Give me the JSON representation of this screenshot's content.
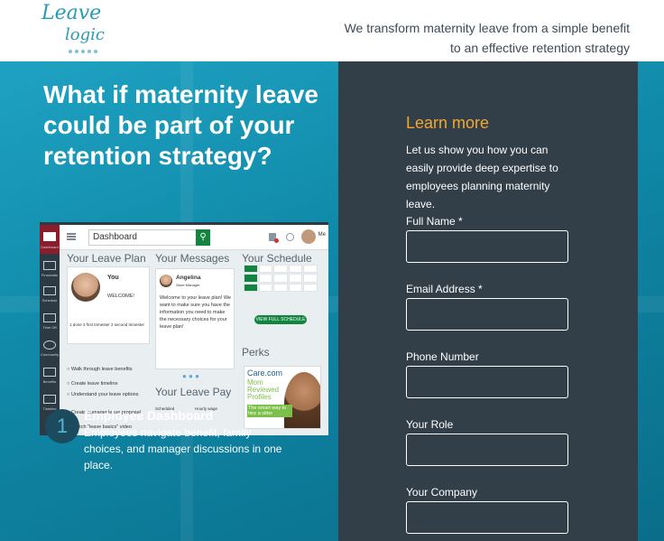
{
  "header": {
    "logo_line1": "Leave",
    "logo_line2": "logic",
    "tagline": "We transform maternity leave from a simple benefit to an effective retention strategy"
  },
  "hero": {
    "title": "What if maternity leave could be part of your retention strategy?"
  },
  "dashboard_mock": {
    "sidebar": [
      "Dashboard",
      "Financials",
      "Schedule",
      "Time Off",
      "Community",
      "Benefits",
      "Timeline"
    ],
    "search_value": "Dashboard",
    "user_label": "Me",
    "plan_heading": "Your Leave Plan",
    "plan_user": "You",
    "plan_welcome": "WELCOME!",
    "plan_stats": "1 done   3 first trimester   2 second trimester",
    "checklist": [
      "Walk through leave benefits",
      "Create leave timeline",
      "Understand your leave options",
      "Create manager leave proposal",
      "Watch \"leave basics\" video"
    ],
    "messages_heading": "Your Messages",
    "message_name": "Angelina",
    "message_role": "Store Manager",
    "message_text": "Welcome to your leave plan! We want to make sure you have the information you need to make the necessary choices for your leave plan!",
    "leave_pay_heading": "Your Leave Pay",
    "leave_pay_scheduled": "Scheduled",
    "leave_pay_hourly": "Hourly wage",
    "schedule_heading": "Your Schedule",
    "schedule_btn": "VIEW FULL SCHEDULE",
    "perks_heading": "Perks",
    "perk_brand": "Care.com",
    "perk_title": "Mom Reviewed Profiles",
    "perk_tag": "The smart way to hire a sitter"
  },
  "step": {
    "number": "1",
    "title": "Employee Dashboard",
    "text": "Employees navigate benefit, family choices, and manager discussions in one place."
  },
  "form": {
    "title": "Learn more",
    "intro": "Let us show you how you can easily provide deep expertise to employees planning maternity leave.",
    "fields": [
      {
        "label": "Full Name *",
        "value": ""
      },
      {
        "label": "Email Address *",
        "value": ""
      },
      {
        "label": "Phone Number",
        "value": ""
      },
      {
        "label": "Your Role",
        "value": ""
      },
      {
        "label": "Your Company",
        "value": ""
      }
    ]
  },
  "colors": {
    "brand": "#2a9bb6",
    "hero_bg": "#1596b6",
    "panel_bg": "#333f48",
    "accent": "#f0a830",
    "green": "#12843f"
  }
}
